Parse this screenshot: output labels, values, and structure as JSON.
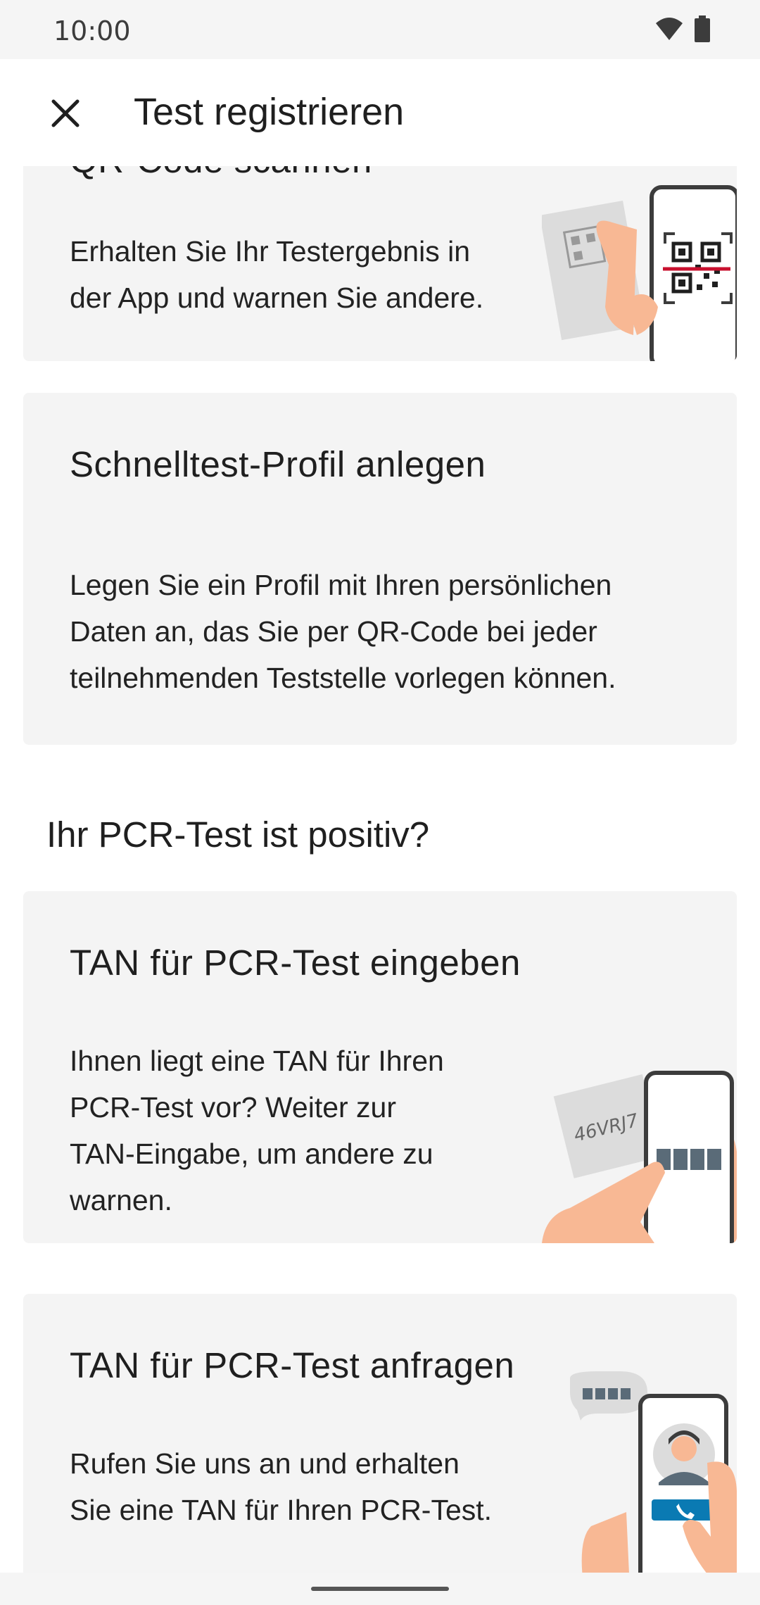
{
  "status_bar": {
    "time": "10:00"
  },
  "app_bar": {
    "title": "Test registrieren"
  },
  "cards": [
    {
      "title": "QR-Code scannen",
      "body": [
        "Erhalten Sie Ihr Testergebnis in",
        "der App und warnen Sie andere."
      ]
    },
    {
      "title": "Schnelltest-Profil anlegen",
      "body": [
        "Legen Sie ein Profil mit Ihren persönlichen",
        "Daten an, das Sie per QR-Code bei jeder",
        "teilnehmenden Teststelle vorlegen können."
      ]
    },
    {
      "title": "TAN für PCR-Test eingeben",
      "body": [
        "Ihnen liegt eine TAN für Ihren",
        "PCR-Test vor? Weiter zur",
        "TAN-Eingabe, um andere zu",
        "warnen."
      ],
      "illustration_text": "46VRJ7"
    },
    {
      "title": "TAN für PCR-Test anfragen",
      "body": [
        "Rufen Sie uns an und erhalten",
        "Sie eine TAN für Ihren PCR-Test."
      ]
    }
  ],
  "section": {
    "heading": "Ihr PCR-Test ist positiv?"
  },
  "colors": {
    "card_bg": "#f4f4f4",
    "skin": "#f8b894",
    "scan_line": "#c8102e",
    "phone_outline": "#3c3c3c",
    "call_button": "#0a7ab3"
  }
}
